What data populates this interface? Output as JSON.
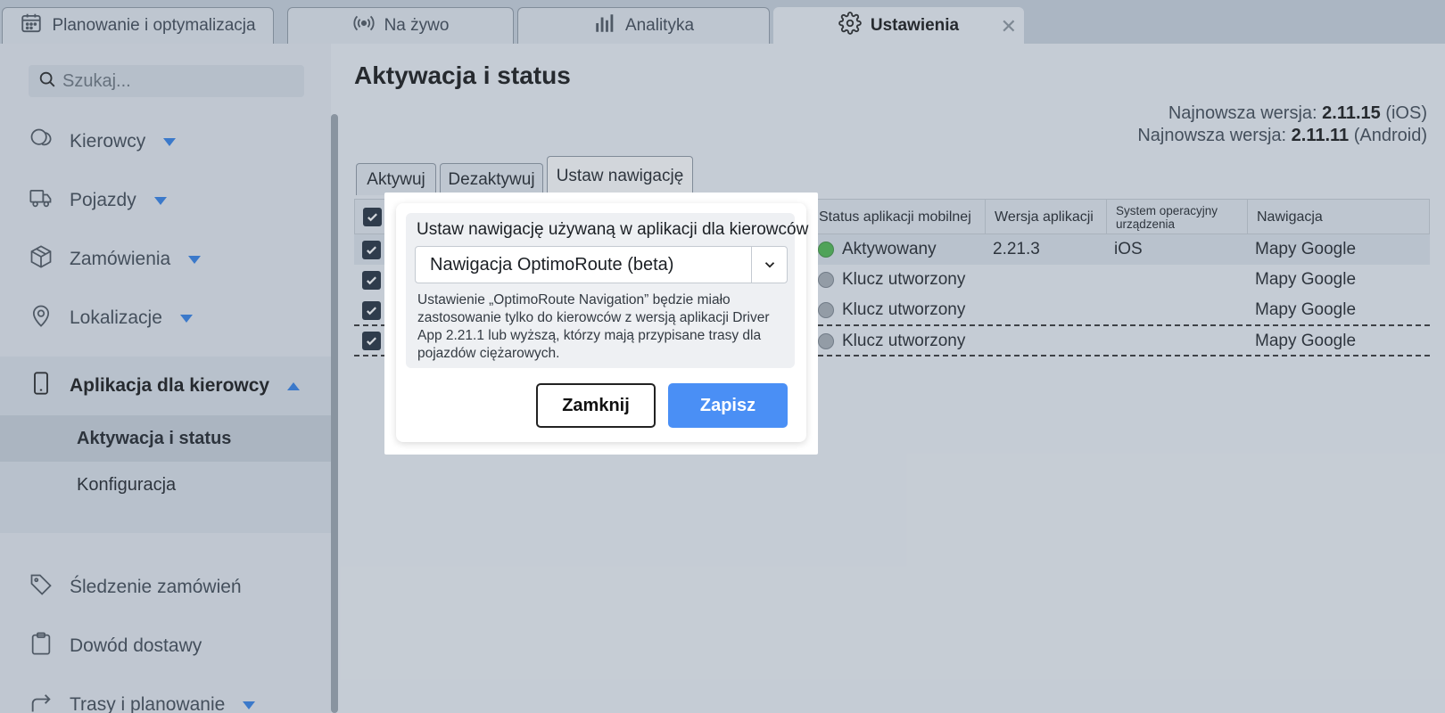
{
  "tabs": [
    {
      "label": "Planowanie i optymalizacja",
      "icon": "calendar-icon"
    },
    {
      "label": "Na żywo",
      "icon": "broadcast-icon"
    },
    {
      "label": "Analityka",
      "icon": "bar-chart-icon"
    },
    {
      "label": "Ustawienia",
      "icon": "gear-icon",
      "active": true
    }
  ],
  "sidebar": {
    "search_placeholder": "Szukaj...",
    "items": [
      {
        "label": "Kierowcy",
        "icon": "drivers-icon",
        "expandable": true
      },
      {
        "label": "Pojazdy",
        "icon": "truck-icon",
        "expandable": true
      },
      {
        "label": "Zamówienia",
        "icon": "box-icon",
        "expandable": true
      },
      {
        "label": "Lokalizacje",
        "icon": "location-pin-icon",
        "expandable": true
      },
      {
        "label": "Aplikacja dla kierowcy",
        "icon": "phone-icon",
        "expanded": true
      },
      {
        "label": "Śledzenie zamówień",
        "icon": "tag-icon"
      },
      {
        "label": "Dowód dostawy",
        "icon": "clipboard-icon"
      },
      {
        "label": "Trasy i planowanie",
        "icon": "route-arrow-icon",
        "expandable": true
      }
    ],
    "subitems": [
      {
        "label": "Aktywacja i status",
        "active": true
      },
      {
        "label": "Konfiguracja"
      }
    ]
  },
  "main": {
    "title": "Aktywacja i status",
    "versions": {
      "prefix": "Najnowsza wersja:",
      "ios_version": "2.11.15",
      "ios_label": "(iOS)",
      "android_version": "2.11.11",
      "android_label": "(Android)"
    },
    "subtabs": [
      "Aktywuj",
      "Dezaktywuj",
      "Ustaw nawigację"
    ],
    "table": {
      "columns": [
        "Status aplikacji mobilnej",
        "Wersja aplikacji",
        "System operacyjny urządzenia",
        "Nawigacja"
      ],
      "rows": [
        {
          "status": "Aktywowany",
          "status_color": "#4cb94c",
          "version": "2.21.3",
          "os": "iOS",
          "navigation": "Mapy Google",
          "checked": true
        },
        {
          "status": "Klucz utworzony",
          "status_color": "#a8afb6",
          "version": "",
          "os": "",
          "navigation": "Mapy Google",
          "checked": true
        },
        {
          "status": "Klucz utworzony",
          "status_color": "#a8afb6",
          "version": "",
          "os": "",
          "navigation": "Mapy Google",
          "checked": true
        },
        {
          "status": "Klucz utworzony",
          "status_color": "#a8afb6",
          "version": "",
          "os": "",
          "navigation": "Mapy Google",
          "checked": true
        }
      ],
      "truncated_cell": "..."
    }
  },
  "modal": {
    "label": "Ustaw nawigację używaną w aplikacji dla kierowców",
    "selected": "Nawigacja OptimoRoute (beta)",
    "note": "Ustawienie „OptimoRoute Navigation” będzie miało zastosowanie tylko do kierowców z wersją aplikacji Driver App 2.21.1 lub wyższą, którzy mają przypisane trasy dla pojazdów ciężarowych.",
    "close_label": "Zamknij",
    "save_label": "Zapisz"
  },
  "colors": {
    "accent": "#2f7ee8",
    "primary_button": "#4a8ff5",
    "status_active": "#4cb94c",
    "status_inactive": "#a8afb6"
  }
}
